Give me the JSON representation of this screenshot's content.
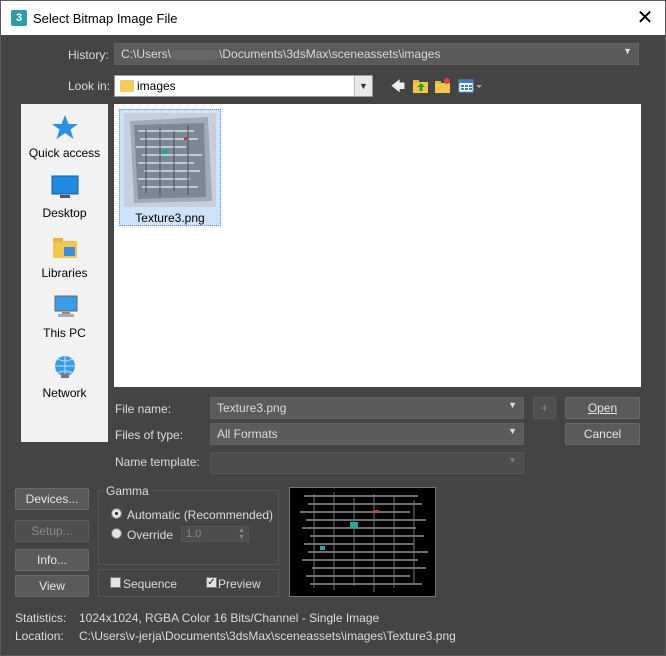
{
  "window": {
    "title": "Select Bitmap Image File",
    "app_icon_label": "3"
  },
  "history": {
    "label": "History:",
    "value_prefix": "C:\\Users\\",
    "value_suffix": "\\Documents\\3dsMax\\sceneassets\\images"
  },
  "lookin": {
    "label": "Look in:",
    "value": "images"
  },
  "places": [
    {
      "label": "Quick access",
      "icon": "star-icon"
    },
    {
      "label": "Desktop",
      "icon": "desktop-icon"
    },
    {
      "label": "Libraries",
      "icon": "libraries-icon"
    },
    {
      "label": "This PC",
      "icon": "computer-icon"
    },
    {
      "label": "Network",
      "icon": "network-icon"
    }
  ],
  "files": [
    {
      "name": "Texture3.png"
    }
  ],
  "form": {
    "file_name_label": "File name:",
    "file_name_value": "Texture3.png",
    "files_of_type_label": "Files of type:",
    "files_of_type_value": "All Formats",
    "name_template_label": "Name template:",
    "name_template_value": "",
    "plus_label": "+"
  },
  "buttons": {
    "open": "Open",
    "cancel": "Cancel",
    "devices": "Devices...",
    "setup": "Setup...",
    "info": "Info...",
    "view": "View"
  },
  "gamma": {
    "label": "Gamma",
    "automatic_label": "Automatic (Recommended)",
    "override_label": "Override",
    "override_value": "1.0",
    "selected": "automatic"
  },
  "options": {
    "sequence_label": "Sequence",
    "sequence_checked": false,
    "preview_label": "Preview",
    "preview_checked": true
  },
  "statistics": {
    "label": "Statistics:",
    "value": "1024x1024, RGBA Color 16 Bits/Channel - Single Image"
  },
  "location": {
    "label": "Location:",
    "value": "C:\\Users\\v-jerja\\Documents\\3dsMax\\sceneassets\\images\\Texture3.png"
  },
  "colors": {
    "dialog_bg": "#444444",
    "field_bg": "#5b5b5b",
    "selection": "#cce3f9",
    "accent": "#2a9fa8"
  }
}
